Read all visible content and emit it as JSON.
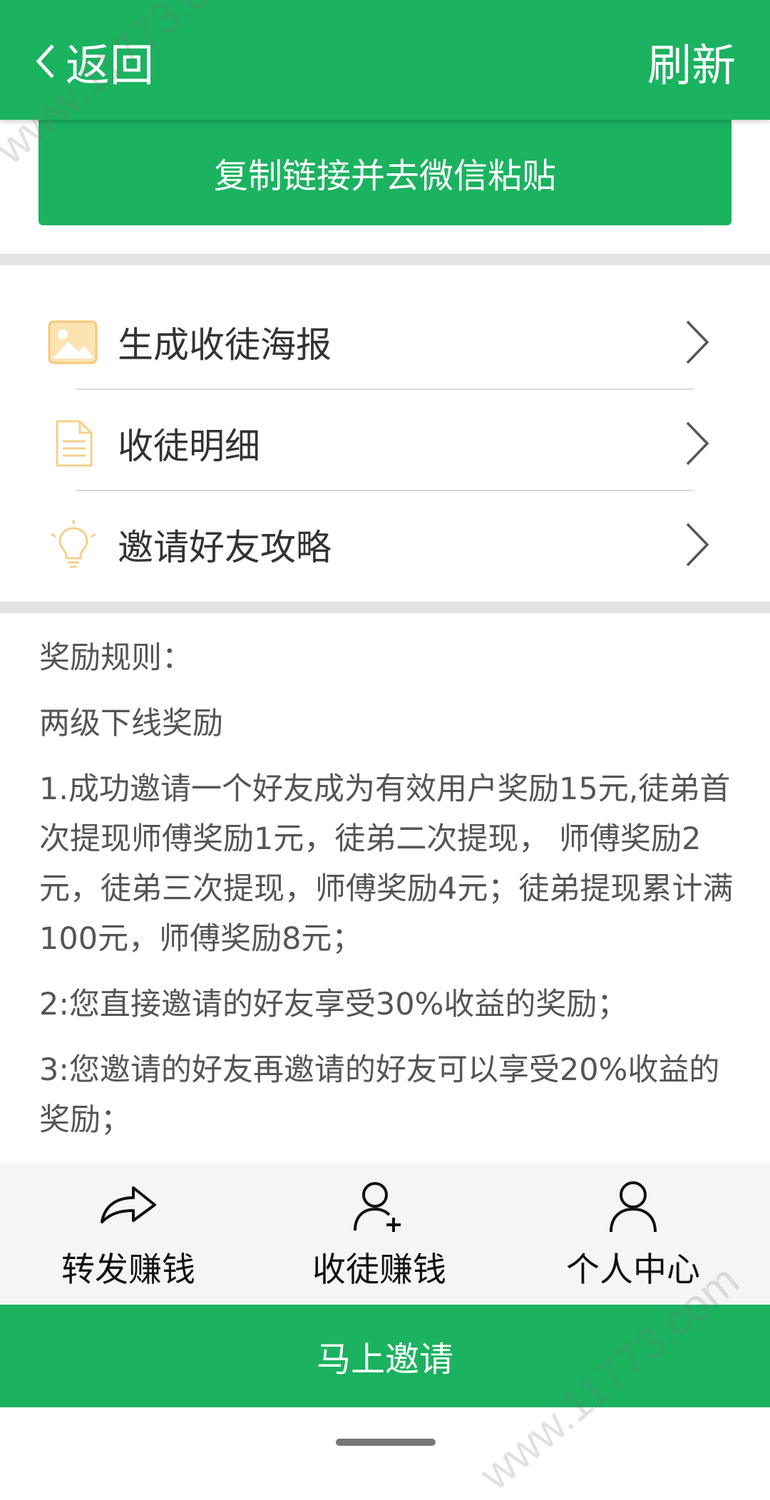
{
  "header": {
    "back_label": "返回",
    "refresh_label": "刷新"
  },
  "copy_button_label": "复制链接并去微信粘贴",
  "menu": {
    "items": [
      {
        "label": "生成收徒海报",
        "icon": "image-icon"
      },
      {
        "label": "收徒明细",
        "icon": "document-icon"
      },
      {
        "label": "邀请好友攻略",
        "icon": "lightbulb-icon"
      }
    ]
  },
  "rules": {
    "title": "奖励规则：",
    "subtitle": "两级下线奖励",
    "items": [
      "1.成功邀请一个好友成为有效用户奖励15元,徒弟首次提现师傅奖励1元，徒弟二次提现， 师傅奖励2元，徒弟三次提现，师傅奖励4元；徒弟提现累计满100元，师傅奖励8元；",
      "2:您直接邀请的好友享受30%收益的奖励；",
      "3:您邀请的好友再邀请的好友可以享受20%收益的奖励；"
    ]
  },
  "tabbar": {
    "items": [
      {
        "label": "转发赚钱",
        "icon": "share-icon"
      },
      {
        "label": "收徒赚钱",
        "icon": "add-user-icon"
      },
      {
        "label": "个人中心",
        "icon": "user-icon"
      }
    ]
  },
  "invite_button_label": "马上邀请",
  "watermarks": [
    "www.11773.com",
    "www.11773.com"
  ],
  "colors": {
    "brand_green": "#1bb260",
    "icon_yellow": "#f7d58a",
    "text_dark": "#333333",
    "text_gray": "#555555"
  }
}
